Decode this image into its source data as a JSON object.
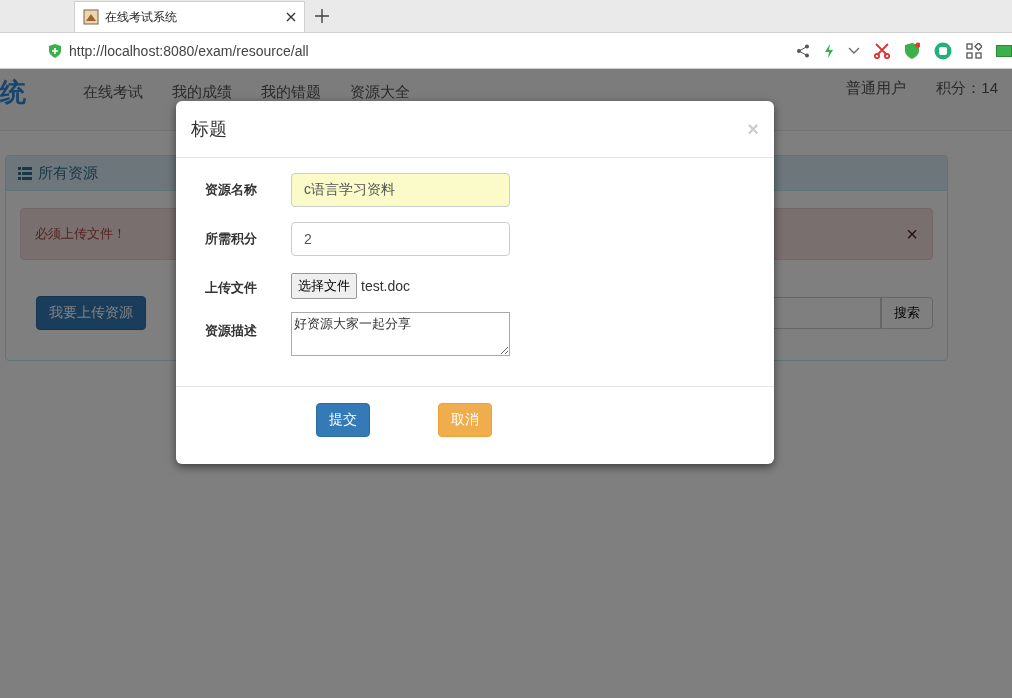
{
  "browser": {
    "tab_title": "在线考试系统",
    "url": "http://localhost:8080/exam/resource/all"
  },
  "navbar": {
    "brand": "统",
    "items": [
      "在线考试",
      "我的成绩",
      "我的错题",
      "资源大全"
    ],
    "user": "普通用户",
    "points": "积分：14"
  },
  "panel": {
    "title": "所有资源",
    "alert": {
      "text": "必须上传文件！",
      "close": "×"
    },
    "upload_button": "我要上传资源",
    "search_button": "搜索"
  },
  "modal": {
    "title": "标题",
    "close": "×",
    "fields": [
      {
        "kind": "text",
        "label": "资源名称",
        "value": "c语言学习资料",
        "autofilled": true
      },
      {
        "kind": "text",
        "label": "所需积分",
        "value": "2",
        "autofilled": false
      },
      {
        "kind": "file",
        "label": "上传文件",
        "button": "选择文件",
        "filename": "test.doc"
      },
      {
        "kind": "textarea",
        "label": "资源描述",
        "value": "好资源大家一起分享"
      }
    ],
    "buttons": [
      {
        "label": "提交",
        "kind": "primary"
      },
      {
        "label": "取消",
        "kind": "warning"
      }
    ]
  }
}
